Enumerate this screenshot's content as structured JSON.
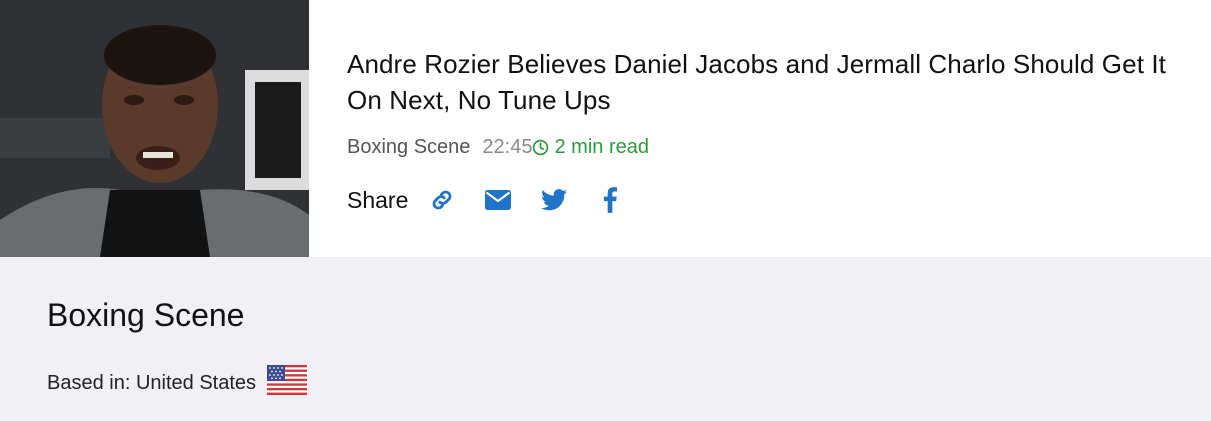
{
  "article": {
    "image_alt": "Daniel Jacobs at press conference",
    "headline": "Andre Rozier Believes Daniel Jacobs and Jermall Charlo Should Get It On Next, No Tune Ups",
    "source": "Boxing Scene",
    "time": "22:45",
    "read_time": "2 min read",
    "share_label": "Share",
    "share_icons": [
      "link-icon",
      "mail-icon",
      "twitter-icon",
      "facebook-icon"
    ]
  },
  "publisher": {
    "name": "Boxing Scene",
    "based_in": "Based in: United States",
    "flag_icon": "us-flag-icon"
  },
  "colors": {
    "accent_blue": "#1f74c9",
    "read_time_green": "#2e9a3e",
    "panel_bg": "#f1f0f4"
  }
}
